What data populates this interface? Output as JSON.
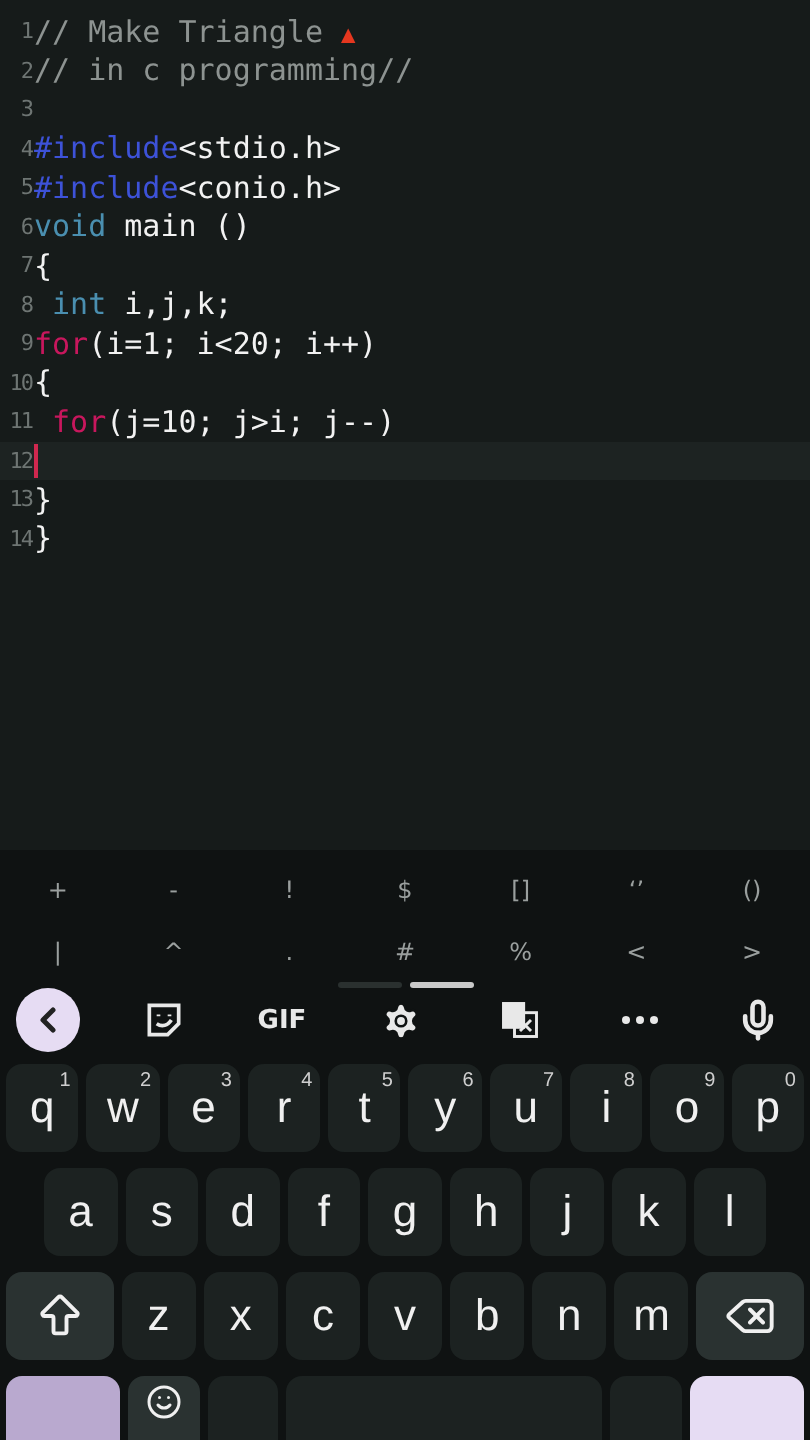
{
  "editor": {
    "lines": [
      {
        "number": "1",
        "current": false,
        "tokens": [
          {
            "kind": "comment",
            "text": "// Make Triangle "
          },
          {
            "kind": "mark",
            "text": "▲"
          }
        ]
      },
      {
        "number": "2",
        "current": false,
        "tokens": [
          {
            "kind": "comment",
            "text": "// in c programming//"
          }
        ]
      },
      {
        "number": "3",
        "current": false
      },
      {
        "number": "4",
        "current": false,
        "tokens": [
          {
            "kind": "directive",
            "text": "#include"
          },
          {
            "kind": "plain",
            "text": "<stdio.h>"
          }
        ]
      },
      {
        "number": "5",
        "current": false,
        "tokens": [
          {
            "kind": "directive",
            "text": "#include"
          },
          {
            "kind": "plain",
            "text": "<conio.h>"
          }
        ]
      },
      {
        "number": "6",
        "current": false,
        "tokens": [
          {
            "kind": "type",
            "text": "void"
          },
          {
            "kind": "plain",
            "text": " main ()"
          }
        ]
      },
      {
        "number": "7",
        "current": false,
        "tokens": [
          {
            "kind": "plain",
            "text": "{"
          }
        ]
      },
      {
        "number": "8",
        "current": false,
        "tokens": [
          {
            "kind": "type",
            "text": " int"
          },
          {
            "kind": "plain",
            "text": " i,j,k;"
          }
        ]
      },
      {
        "number": "9",
        "current": false,
        "tokens": [
          {
            "kind": "keyword",
            "text": "for"
          },
          {
            "kind": "plain",
            "text": "(i=1; i<20; i++)"
          }
        ]
      },
      {
        "number": "10",
        "current": false,
        "tokens": [
          {
            "kind": "plain",
            "text": "{"
          }
        ]
      },
      {
        "number": "11",
        "current": false,
        "tokens": [
          {
            "kind": "keyword",
            "text": " for"
          },
          {
            "kind": "plain",
            "text": "(j=10; j>i; j--)"
          }
        ]
      },
      {
        "number": "12",
        "current": true
      },
      {
        "number": "13",
        "current": false,
        "tokens": [
          {
            "kind": "plain",
            "text": "}"
          }
        ]
      },
      {
        "number": "14",
        "current": false,
        "tokens": [
          {
            "kind": "plain",
            "text": "}"
          }
        ]
      }
    ]
  },
  "symbol_bar": {
    "rows": [
      [
        "+",
        "-",
        "!",
        "$",
        "[]",
        "‘’",
        "()"
      ],
      [
        "|",
        "^",
        ".",
        "#",
        "%",
        "<",
        ">"
      ]
    ],
    "pages": [
      {
        "selected": false
      },
      {
        "selected": true
      }
    ]
  },
  "toolbar": {
    "items": [
      {
        "kind": "back"
      },
      {
        "kind": "sticker"
      },
      {
        "kind": "gif",
        "text": "GIF"
      },
      {
        "kind": "settings"
      },
      {
        "kind": "translate"
      },
      {
        "kind": "more"
      },
      {
        "kind": "mic"
      }
    ]
  },
  "keyboard": {
    "rows": [
      [
        {
          "kind": "letter",
          "label": "q",
          "hint": "1"
        },
        {
          "kind": "letter",
          "label": "w",
          "hint": "2"
        },
        {
          "kind": "letter",
          "label": "e",
          "hint": "3"
        },
        {
          "kind": "letter",
          "label": "r",
          "hint": "4"
        },
        {
          "kind": "letter",
          "label": "t",
          "hint": "5"
        },
        {
          "kind": "letter",
          "label": "y",
          "hint": "6"
        },
        {
          "kind": "letter",
          "label": "u",
          "hint": "7"
        },
        {
          "kind": "letter",
          "label": "i",
          "hint": "8"
        },
        {
          "kind": "letter",
          "label": "o",
          "hint": "9"
        },
        {
          "kind": "letter",
          "label": "p",
          "hint": "0"
        }
      ],
      [
        {
          "kind": "letter",
          "label": "a"
        },
        {
          "kind": "letter",
          "label": "s"
        },
        {
          "kind": "letter",
          "label": "d"
        },
        {
          "kind": "letter",
          "label": "f"
        },
        {
          "kind": "letter",
          "label": "g"
        },
        {
          "kind": "letter",
          "label": "h"
        },
        {
          "kind": "letter",
          "label": "j"
        },
        {
          "kind": "letter",
          "label": "k"
        },
        {
          "kind": "letter",
          "label": "l"
        }
      ],
      [
        {
          "kind": "shift"
        },
        {
          "kind": "letter",
          "label": "z"
        },
        {
          "kind": "letter",
          "label": "x"
        },
        {
          "kind": "letter",
          "label": "c"
        },
        {
          "kind": "letter",
          "label": "v"
        },
        {
          "kind": "letter",
          "label": "b"
        },
        {
          "kind": "letter",
          "label": "n"
        },
        {
          "kind": "letter",
          "label": "m"
        },
        {
          "kind": "backspace"
        }
      ],
      [
        {
          "kind": "symbols"
        },
        {
          "kind": "emoji"
        },
        {
          "kind": "comma"
        },
        {
          "kind": "space"
        },
        {
          "kind": "period"
        },
        {
          "kind": "enter"
        }
      ]
    ]
  }
}
